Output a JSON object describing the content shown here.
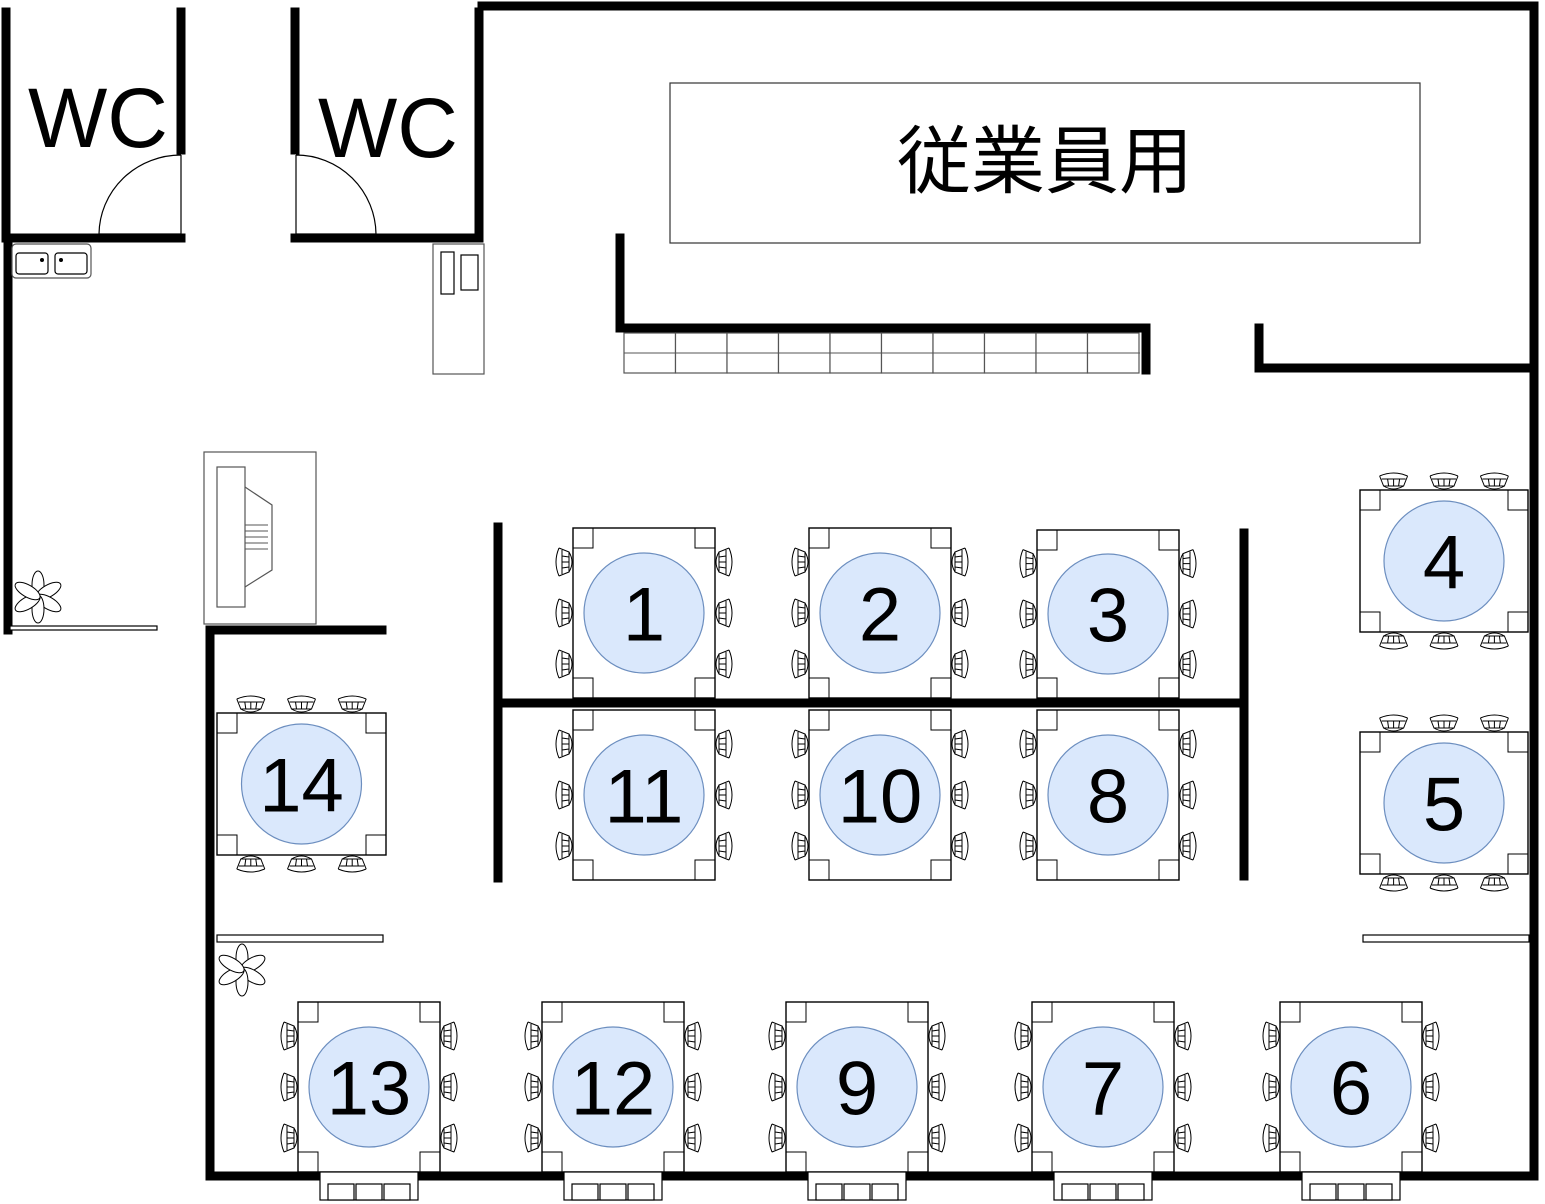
{
  "rooms": {
    "wc_left": "WC",
    "wc_right": "WC",
    "staff_area": "従業員用"
  },
  "tables": [
    "1",
    "2",
    "3",
    "4",
    "5",
    "6",
    "7",
    "8",
    "9",
    "10",
    "11",
    "12",
    "13",
    "14"
  ],
  "colors": {
    "table_marker_fill": "#dae8fc",
    "table_marker_stroke": "#6c8ebf",
    "wall": "#000000"
  }
}
